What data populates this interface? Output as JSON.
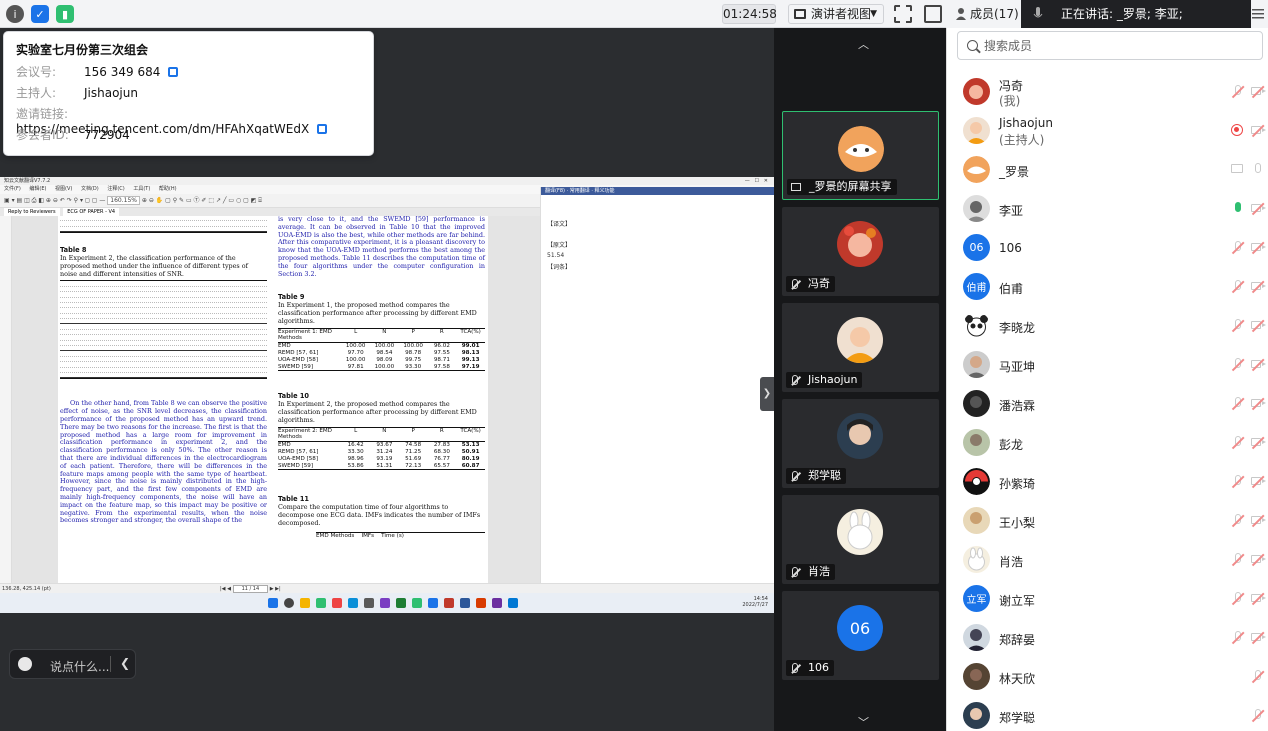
{
  "topbar": {
    "timer": "01:24:58",
    "presenter_view": "演讲者视图"
  },
  "meeting": {
    "title": "实验室七月份第三次组会",
    "id_label": "会议号:",
    "id_value": "156 349 684",
    "host_label": "主持人:",
    "host_value": "Jishaojun",
    "link_label": "邀请链接:",
    "link_value": "https://meeting.tencent.com/dm/HFAhXqatWEdX",
    "participant_id_label": "参会者ID:",
    "participant_id_value": "772904"
  },
  "shared_screen": {
    "app_title": "知云文献翻译V7.7.2",
    "menu": [
      "文件(F)",
      "编辑(E)",
      "视图(V)",
      "文档(D)",
      "注释(C)",
      "工具(T)",
      "帮助(H)"
    ],
    "zoom": "160.15%",
    "tabs": [
      "Reply to Reviewers",
      "ECG OF PAPER - V4"
    ],
    "left_col": {
      "table_title": "Table 8",
      "table_caption": "In Experiment 2, the classification performance of the proposed method under the influence of different types of noise and different intensities of SNR.",
      "body": "On the other hand, from Table 8 we can observe the positive effect of noise, as the SNR level decreases, the classification performance of the proposed method has an upward trend. There may be two reasons for the increase. The first is that the proposed method has a large room for improvement in classification performance in experiment 2, and the classification performance is only 50%. The other reason is that there are individual differences in the electrocardiogram of each patient. Therefore, there will be differences in the feature maps among people with the same type of heartbeat. However, since the noise is mainly distributed in the high-frequency part, and the first few components of EMD are mainly high-frequency components, the noise will have an impact on the feature map, so this impact may be positive or negative. From the experimental results, when the noise becomes stronger and stronger, the overall shape of the"
    },
    "right_col": {
      "intro": "is very close to it, and the SWEMD [59] performance is average. It can be observed in Table 10 that the improved UOA-EMD is also the best, while other methods are far behind. After this comparative experiment, it is a pleasant discovery to know that the UOA-EMD method performs the best among the proposed methods. Table 11 describes the computation time of the four algorithms under the computer configuration in Section 3.2.",
      "t9_title": "Table 9",
      "t9_caption": "In Experiment 1, the proposed method compares the classification performance after processing by different EMD algorithms.",
      "t9_header": [
        "Experiment 1: EMD Methods",
        "L",
        "N",
        "P",
        "R",
        "TCA(%)"
      ],
      "t9_rows": [
        [
          "EMD",
          "100.00",
          "100.00",
          "100.00",
          "96.02",
          "99.01"
        ],
        [
          "REMD [57, 61]",
          "97.70",
          "98.54",
          "98.78",
          "97.55",
          "98.13"
        ],
        [
          "UOA-EMD [58]",
          "100.00",
          "98.09",
          "99.75",
          "98.71",
          "99.13"
        ],
        [
          "SWEMD [59]",
          "97.81",
          "100.00",
          "93.30",
          "97.58",
          "97.19"
        ]
      ],
      "t10_title": "Table 10",
      "t10_caption": "In Experiment 2, the proposed method compares the classification performance after processing by different EMD algorithms.",
      "t10_header": [
        "Experiment 2: EMD Methods",
        "L",
        "N",
        "P",
        "R",
        "TCA(%)"
      ],
      "t10_rows": [
        [
          "EMD",
          "16.42",
          "93.67",
          "74.58",
          "27.83",
          "53.13"
        ],
        [
          "REMD [57, 61]",
          "33.30",
          "31.24",
          "71.25",
          "68.30",
          "50.91"
        ],
        [
          "UOA-EMD [58]",
          "98.96",
          "93.19",
          "51.69",
          "76.77",
          "80.19"
        ],
        [
          "SWEMD [59]",
          "53.86",
          "51.31",
          "72.13",
          "65.57",
          "60.87"
        ]
      ],
      "t11_title": "Table 11",
      "t11_caption": "Compare the computation time of four algorithms to decompose one ECG data. IMFs indicates the number of IMFs decomposed.",
      "t11_header": "EMD Methods    IMFs    Time (s)"
    },
    "translate": {
      "head": "翻译(F8)  ·  常用翻译  ·  释义功能",
      "line1": "【译文】",
      "line2": "【原文】",
      "line3": "51.54",
      "line4": "【词条】"
    },
    "status_left": "136.28, 425.14 (pt)",
    "page_indicator": "11 / 14",
    "clock_time": "14:54",
    "clock_date": "2022/7/27"
  },
  "chat": {
    "placeholder": "说点什么..."
  },
  "videos": [
    {
      "name": "_罗景的屏幕共享",
      "active": true
    },
    {
      "name": "冯奇"
    },
    {
      "name": "Jishaojun"
    },
    {
      "name": "郑学聪"
    },
    {
      "name": "肖浩"
    },
    {
      "name": "106",
      "avatar_text": "06"
    }
  ],
  "panel": {
    "members_tab": "成员(17)",
    "speaking": "正在讲话: _罗景; 李亚;",
    "search_placeholder": "搜索成员",
    "members": [
      {
        "name": "冯奇",
        "sub": "(我)"
      },
      {
        "name": "Jishaojun",
        "sub": "(主持人)"
      },
      {
        "name": "_罗景"
      },
      {
        "name": "李亚"
      },
      {
        "name": "106",
        "avatar_text": "06"
      },
      {
        "name": "伯甫",
        "avatar_text": "伯甫"
      },
      {
        "name": "李晓龙"
      },
      {
        "name": "马亚坤"
      },
      {
        "name": "潘浩霖"
      },
      {
        "name": "彭龙"
      },
      {
        "name": "孙紫琦"
      },
      {
        "name": "王小梨"
      },
      {
        "name": "肖浩"
      },
      {
        "name": "谢立军",
        "avatar_text": "立军"
      },
      {
        "name": "郑辞晏"
      },
      {
        "name": "林天欣"
      },
      {
        "name": "郑学聪"
      }
    ]
  },
  "colors": {
    "accent": "#1a73e8",
    "active": "#2fbf71",
    "dark": "#17181a"
  }
}
